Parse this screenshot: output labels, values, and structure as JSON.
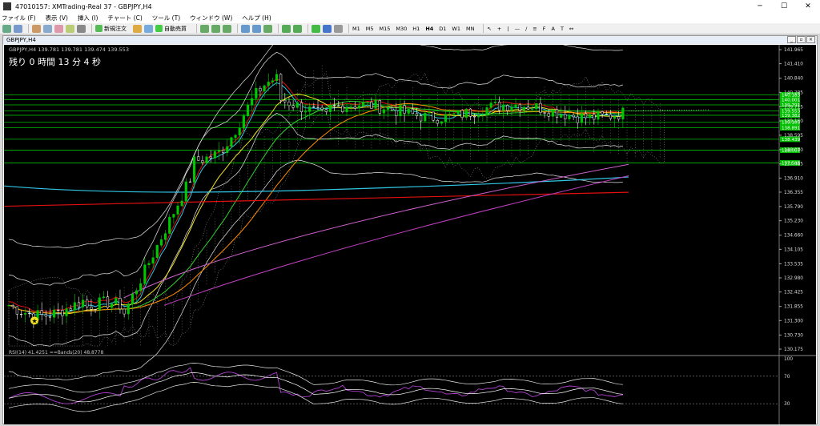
{
  "window": {
    "title": "47010157: XMTrading-Real 37 - GBPJPY,H4"
  },
  "menu": [
    "ファイル (F)",
    "表示 (V)",
    "挿入 (I)",
    "チャート (C)",
    "ツール (T)",
    "ウィンドウ (W)",
    "ヘルプ (H)"
  ],
  "toolbar": {
    "new_order": "新規注文",
    "auto_trade": "自動売買",
    "timeframes": [
      "M1",
      "M5",
      "M15",
      "M30",
      "H1",
      "H4",
      "D1",
      "W1",
      "MN"
    ],
    "active_tf": "H4"
  },
  "chart": {
    "tab_title": "GBPJPY,H4",
    "ohlc_label": "GBPJPY,H4  139.781 139.781 139.474 139.553",
    "timer": "残り 0 時間 13 分 4 秒",
    "price_axis": [
      "141.965",
      "141.410",
      "140.840",
      "140.285",
      "139.715",
      "139.160",
      "138.595",
      "138.030",
      "137.465",
      "136.910",
      "136.355",
      "135.790",
      "135.230",
      "134.660",
      "134.105",
      "133.535",
      "132.980",
      "132.425",
      "131.855",
      "131.300",
      "130.730",
      "130.175"
    ],
    "green_levels": [
      "140.183",
      "140.001",
      "139.791",
      "139.553",
      "139.382",
      "139.105",
      "138.891",
      "138.439",
      "138.007",
      "137.503"
    ],
    "rsi_label": "RSI(14) 41.4251  ==Bands(20) 48.8778",
    "rsi_axis": [
      "100",
      "70",
      "30"
    ],
    "colors": {
      "bg": "#000000",
      "up": "#00c800",
      "down": "#ff2a2a",
      "level": "#00c000",
      "cyan": "#31c6e6",
      "red_ma": "#e01010",
      "violet": "#cc55cc",
      "orange": "#ff8c00",
      "yellow": "#f0e020"
    }
  }
}
